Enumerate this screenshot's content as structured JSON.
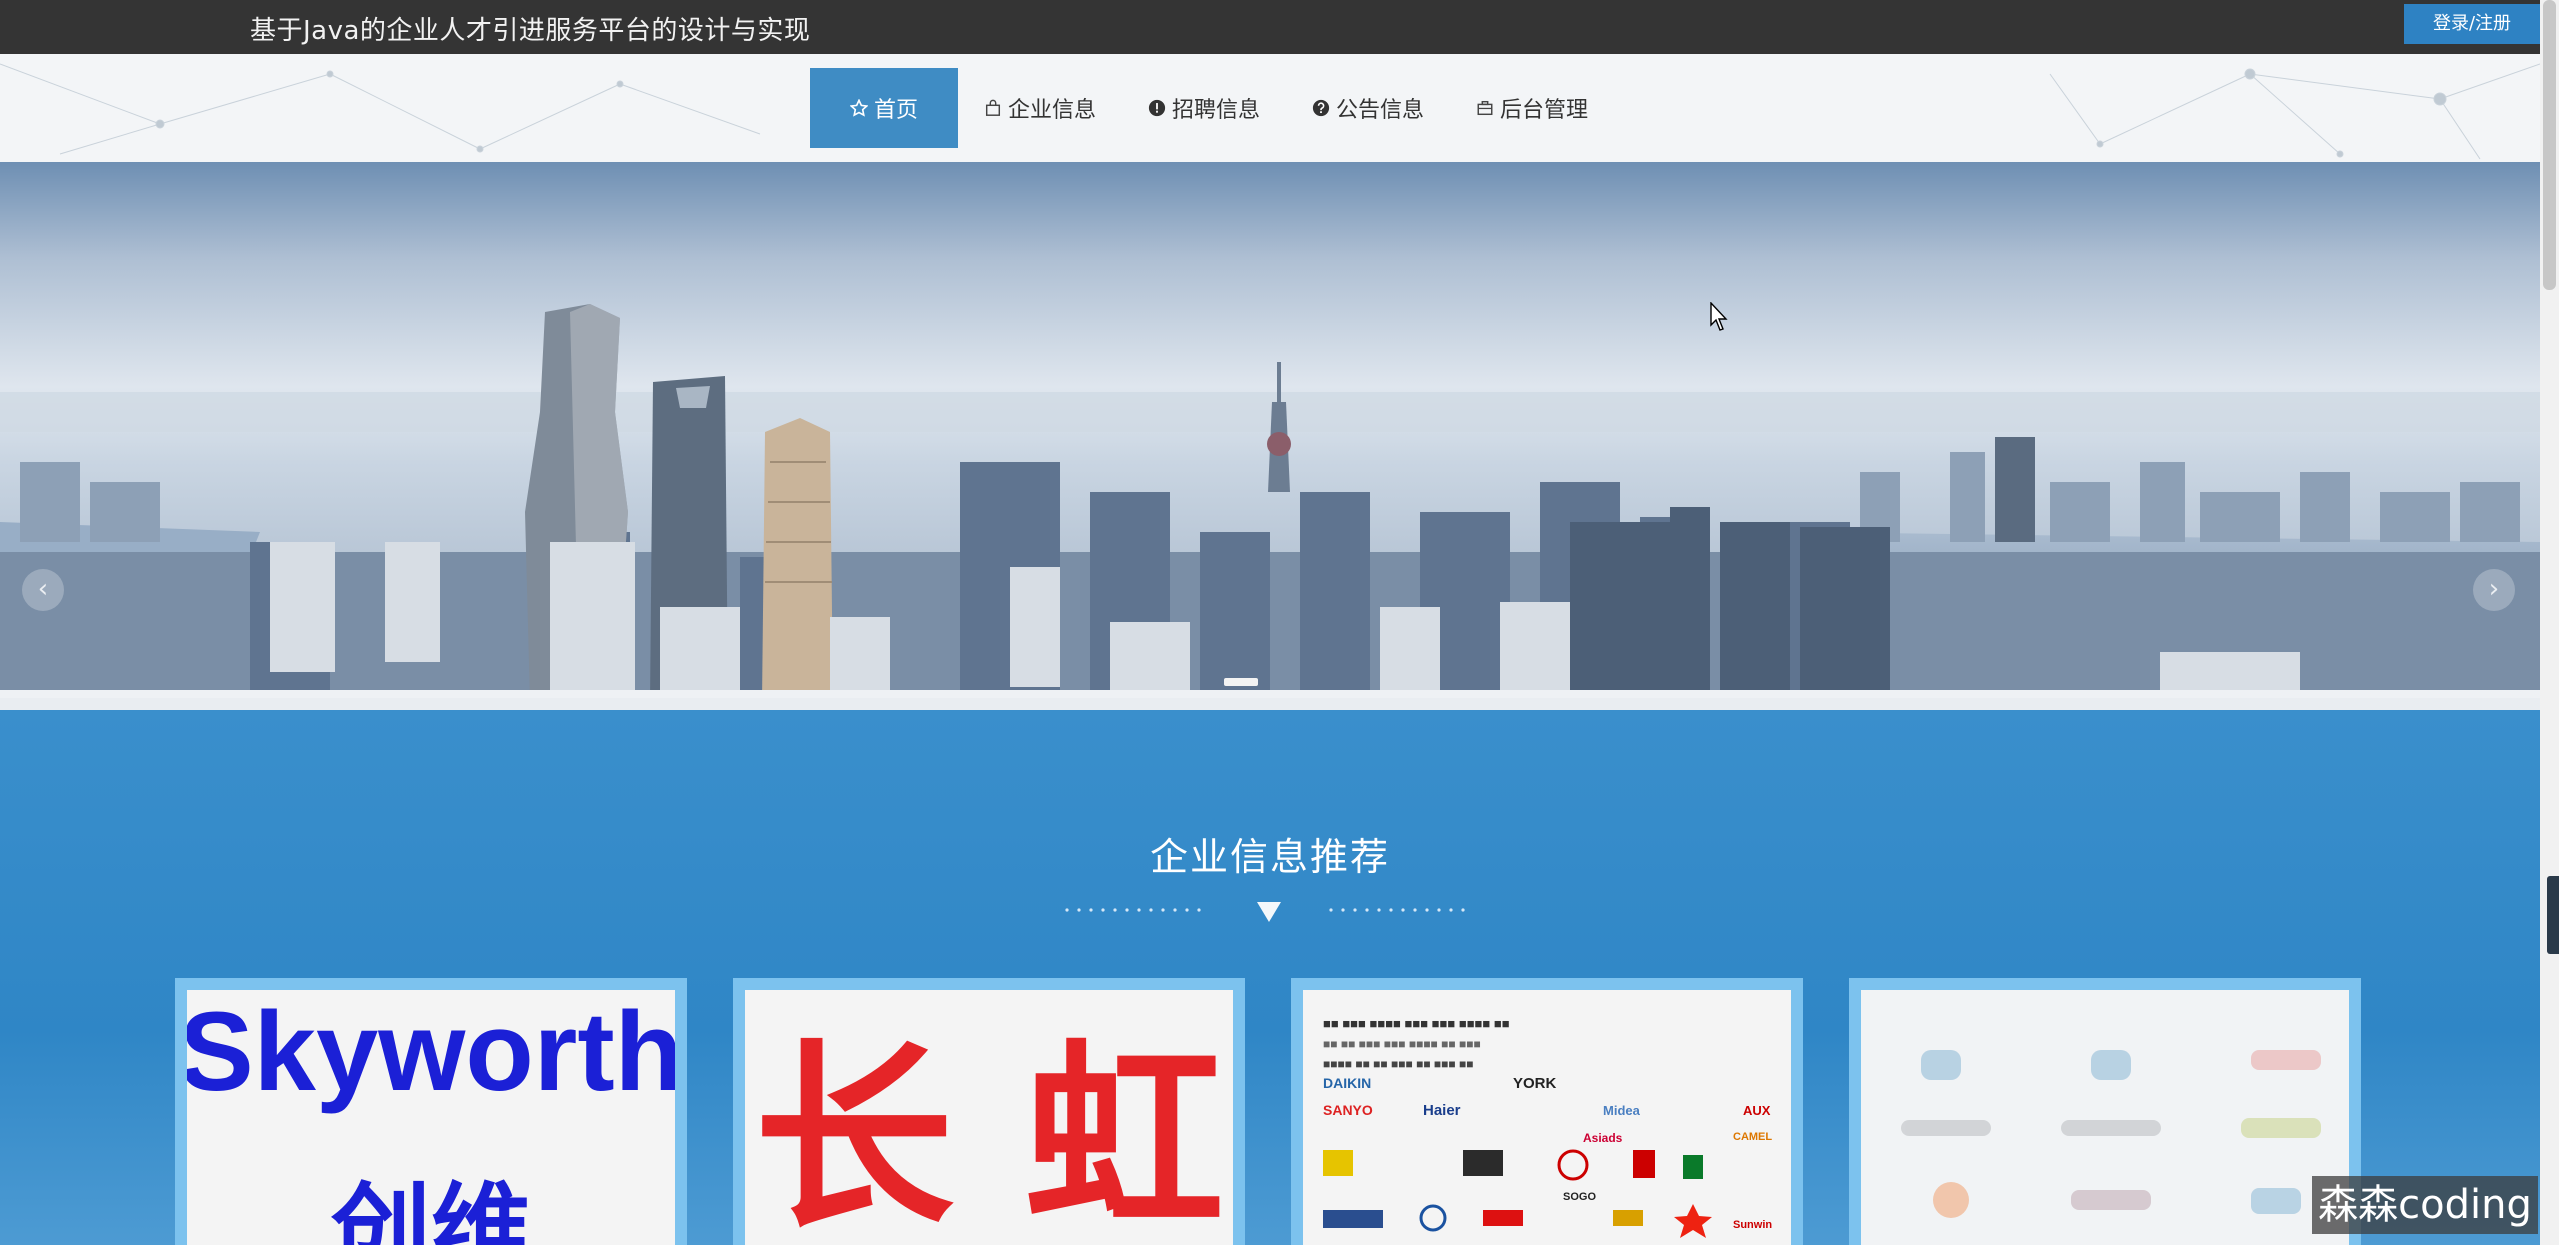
{
  "header": {
    "site_title": "基于Java的企业人才引进服务平台的设计与实现",
    "login_label": "登录/注册"
  },
  "nav": {
    "items": [
      {
        "label": "首页",
        "icon": "star-icon",
        "active": true
      },
      {
        "label": "企业信息",
        "icon": "bag-icon"
      },
      {
        "label": "招聘信息",
        "icon": "exclamation-circle-icon"
      },
      {
        "label": "公告信息",
        "icon": "question-circle-icon"
      },
      {
        "label": "后台管理",
        "icon": "briefcase-icon"
      }
    ]
  },
  "banner": {
    "prev_glyph": "‹",
    "next_glyph": "›"
  },
  "section": {
    "title": "企业信息推荐"
  },
  "cards": [
    {
      "logo_text_1": "Skyworth",
      "logo_text_2": "创维"
    },
    {
      "logo_text": "长 虹"
    },
    {
      "logo_wall": [
        "SANYO",
        "Haier",
        "YORK",
        "DAIKIN",
        "Midea",
        "AUX",
        "CAMEL",
        "Sunwin",
        "SOGO",
        "Asiads"
      ]
    },
    {
      "blurred": true
    }
  ],
  "watermark": "森森coding",
  "colors": {
    "topbar": "#343434",
    "accent": "#3f8cc4",
    "section_bg": "#2f86c6",
    "card_border": "#7cc2ee",
    "skyworth_blue": "#1b20d6",
    "changhong_red": "#e52528"
  }
}
